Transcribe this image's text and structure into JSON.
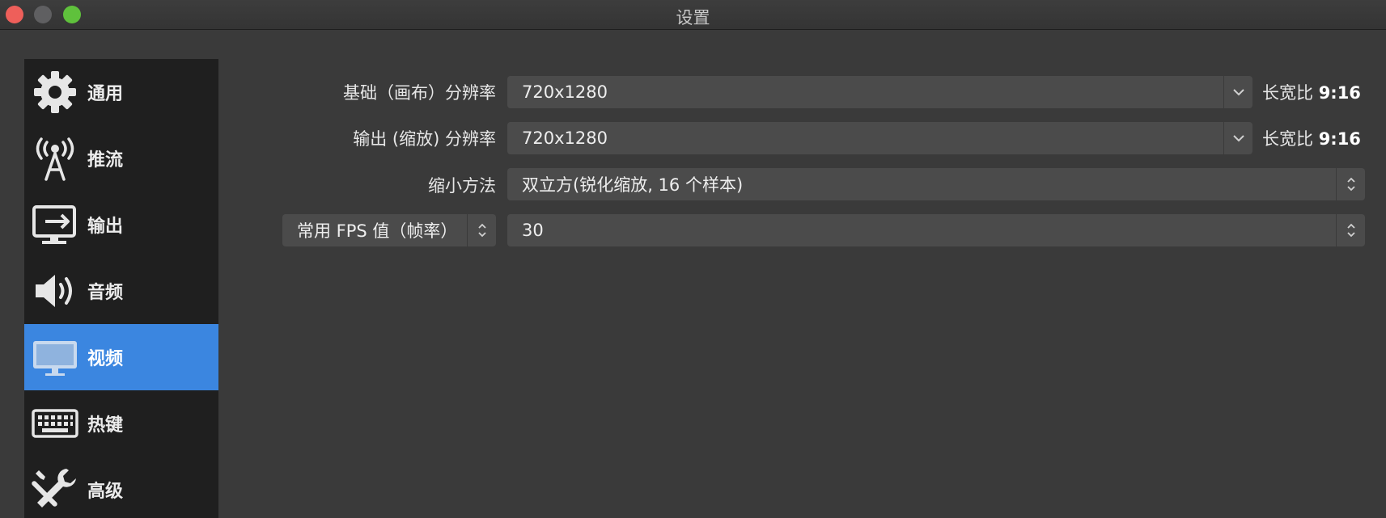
{
  "window": {
    "title": "设置"
  },
  "sidebar": {
    "items": [
      {
        "label": "通用",
        "icon": "gear-icon"
      },
      {
        "label": "推流",
        "icon": "broadcast-tower-icon"
      },
      {
        "label": "输出",
        "icon": "output-monitor-icon"
      },
      {
        "label": "音频",
        "icon": "speaker-icon"
      },
      {
        "label": "视频",
        "icon": "monitor-icon",
        "selected": true
      },
      {
        "label": "热键",
        "icon": "keyboard-icon"
      },
      {
        "label": "高级",
        "icon": "tools-icon"
      }
    ]
  },
  "video": {
    "base_resolution": {
      "label": "基础（画布）分辨率",
      "value": "720x1280",
      "aspect_label": "长宽比",
      "aspect_value": "9:16"
    },
    "output_resolution": {
      "label": "输出 (缩放) 分辨率",
      "value": "720x1280",
      "aspect_label": "长宽比",
      "aspect_value": "9:16"
    },
    "downscale_filter": {
      "label": "缩小方法",
      "value": "双立方(锐化缩放, 16 个样本)"
    },
    "fps": {
      "type_label": "常用 FPS 值（帧率）",
      "value": "30"
    }
  },
  "colors": {
    "accent": "#3b86e0",
    "sidebar_bg": "#1f1f1f",
    "window_bg": "#3a3a3a",
    "field_bg": "#4b4b4b",
    "close": "#ee5f5a",
    "minimize": "#5f5f61",
    "zoom": "#5fc13c"
  }
}
